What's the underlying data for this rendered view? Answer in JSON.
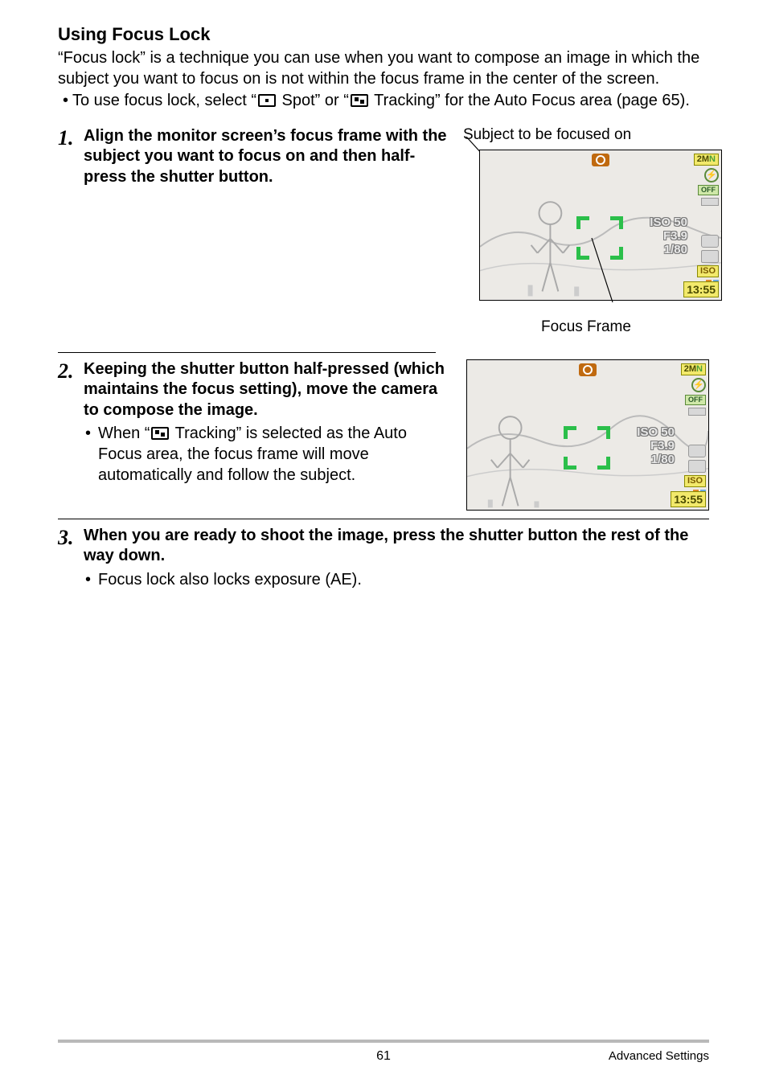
{
  "heading": "Using Focus Lock",
  "intro": "“Focus lock” is a technique you can use when you want to compose an image in which the subject you want to focus on is not within the focus frame in the center of the screen.",
  "preBullet": {
    "before": "To use focus lock, select “",
    "spot": " Spot” or “",
    "tracking": " Tracking” for the Auto Focus area (page 65)."
  },
  "step1": {
    "num": "1.",
    "title": "Align the monitor screen’s focus frame with the subject you want to focus on and then half-press the shutter button.",
    "rightLabel": "Subject to be focused on",
    "focusFrameLabel": "Focus Frame"
  },
  "step2": {
    "num": "2.",
    "title": "Keeping the shutter button half-pressed (which maintains the focus setting), move the camera to compose the image.",
    "bulletBefore": "When “",
    "bulletAfter": " Tracking” is selected as the Auto Focus area, the focus frame will move automatically and follow the subject."
  },
  "step3": {
    "num": "3.",
    "title": "When you are ready to shoot the image, press the shutter button the rest of the way down.",
    "bullet": "Focus lock also locks exposure (AE)."
  },
  "camera": {
    "imgSize": "2M",
    "sizeSuffix": "N",
    "flashIcon": "⊙",
    "off": "OFF",
    "iso": "ISO 50",
    "fstop": "F3.9",
    "shutter": "1/80",
    "isoSide": "ISO",
    "time": "13:55"
  },
  "footer": {
    "page": "61",
    "section": "Advanced Settings"
  }
}
